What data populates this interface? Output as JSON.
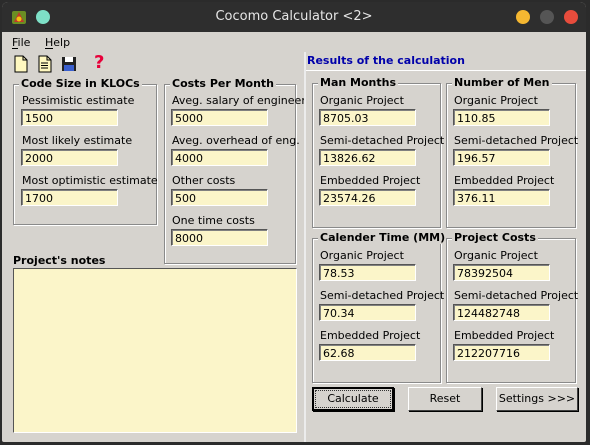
{
  "window": {
    "title": "Cocomo Calculator <2>"
  },
  "menu": {
    "file": "File",
    "help": "Help"
  },
  "toolbar": {
    "help_glyph": "?"
  },
  "code_size": {
    "title": "Code Size in KLOCs",
    "pessimistic_label": "Pessimistic estimate",
    "pessimistic_value": "1500",
    "likely_label": "Most likely estimate",
    "likely_value": "2000",
    "optimistic_label": "Most optimistic estimate",
    "optimistic_value": "1700"
  },
  "costs": {
    "title": "Costs Per Month",
    "salary_label": "Aveg. salary of engineer",
    "salary_value": "5000",
    "overhead_label": "Aveg. overhead of eng.",
    "overhead_value": "4000",
    "other_label": "Other costs",
    "other_value": "500",
    "onetime_label": "One time costs",
    "onetime_value": "8000"
  },
  "notes": {
    "title": "Project's notes",
    "value": ""
  },
  "results": {
    "title": "Results of the calculation",
    "man_months": {
      "title": "Man Months",
      "organic_label": "Organic Project",
      "organic": "8705.03",
      "semi_label": "Semi-detached Project",
      "semi": "13826.62",
      "embedded_label": "Embedded Project",
      "embedded": "23574.26"
    },
    "men": {
      "title": "Number of Men",
      "organic_label": "Organic Project",
      "organic": "110.85",
      "semi_label": "Semi-detached Project",
      "semi": "196.57",
      "embedded_label": "Embedded Project",
      "embedded": "376.11"
    },
    "time": {
      "title": "Calender Time (MM)",
      "organic_label": "Organic Project",
      "organic": "78.53",
      "semi_label": "Semi-detached Project",
      "semi": "70.34",
      "embedded_label": "Embedded Project",
      "embedded": "62.68"
    },
    "costs": {
      "title": "Project Costs",
      "organic_label": "Organic Project",
      "organic": "78392504",
      "semi_label": "Semi-detached Project",
      "semi": "124482748",
      "embedded_label": "Embedded Project",
      "embedded": "212207716"
    }
  },
  "buttons": {
    "calculate": "Calculate",
    "reset": "Reset",
    "settings": "Settings >>>"
  },
  "colors": {
    "field_bg": "#fbf5c9",
    "window_bg": "#d6d3ce",
    "results_title": "#0000aa",
    "close": "#e74c3c",
    "minimize": "#f5b731",
    "maximize": "#555555",
    "accent_dot": "#7ee0c7"
  }
}
